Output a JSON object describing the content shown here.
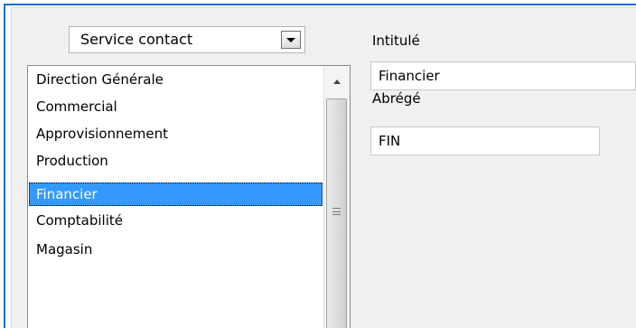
{
  "service_selector": {
    "value": "Service contact",
    "icon": "chevron-down-icon"
  },
  "departments": {
    "items": [
      "Direction Générale",
      "Commercial",
      "Approvisionnement",
      "Production",
      "Financier",
      "Comptabilité",
      "Magasin"
    ],
    "selected": "Financier"
  },
  "form": {
    "title_label": "Intitulé",
    "title_value": "Financier",
    "short_label": "Abrégé",
    "short_value": "FIN"
  },
  "colors": {
    "frame_border": "#1c6fd6",
    "panel_background": "#f0f0f0",
    "selection": "#3399ff"
  }
}
